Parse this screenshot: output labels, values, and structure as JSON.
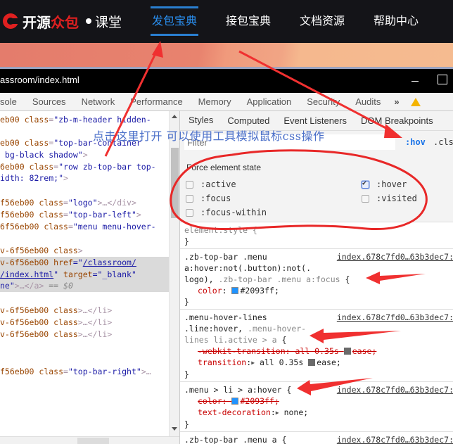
{
  "site": {
    "logo": {
      "part1": "开源",
      "part2": "众包",
      "part3": "课堂"
    },
    "nav": [
      {
        "label": "发包宝典",
        "active": true
      },
      {
        "label": "接包宝典",
        "active": false
      },
      {
        "label": "文档资源",
        "active": false
      },
      {
        "label": "帮助中心",
        "active": false
      }
    ],
    "accent_color": "#2093ff"
  },
  "devtools": {
    "window_title": "assroom/index.html",
    "tabs": [
      "sole",
      "Sources",
      "Network",
      "Performance",
      "Memory",
      "Application",
      "Security",
      "Audits"
    ],
    "more_tabs_icon": "»",
    "elements": {
      "lines": {
        "l0": {
          "pre": "eb00 ",
          "attr": "class",
          "val": "\"zb-m-header hidden-"
        },
        "l1": {
          "pre": "eb00 ",
          "attr": "class",
          "val": "\"top-bar-container"
        },
        "l2": {
          "val": " bg-black shadow\"",
          "post": ">"
        },
        "l3": {
          "pre": "6eb00 ",
          "attr": "class",
          "val": "\"row zb-top-bar top-"
        },
        "l4": {
          "val": "idth: 82rem;\"",
          "post": ">"
        },
        "l5": {
          "pre": "f56eb00 ",
          "attr": "class",
          "val": "\"logo\"",
          "post": ">…</div>"
        },
        "l6": {
          "pre": "f56eb00 ",
          "attr": "class",
          "val": "\"top-bar-left\"",
          "post": ">"
        },
        "l7": {
          "pre": "6f56eb00 ",
          "attr": "class",
          "val": "\"menu menu-hover-"
        },
        "l8": {
          "pre": "v-6f56eb00 ",
          "attr": "class",
          "post": ">"
        },
        "l9": {
          "pre": "v-6f56eb00 ",
          "attr": "href",
          "eq": "=\"",
          "link": "/classroom/"
        },
        "l10": {
          "link": "/index.html",
          "q": "\"",
          "attr": " target",
          "val": "=\"_blank\""
        },
        "l11": {
          "val": "ne\"",
          "post": ">…</a>",
          "console": " == $0"
        },
        "l12": {
          "pre": "v-6f56eb00 ",
          "attr": "class",
          "post": ">…</li>"
        },
        "l13": {
          "pre": "v-6f56eb00 ",
          "attr": "class",
          "post": ">…</li>"
        },
        "l14": {
          "pre": "v-6f56eb00 ",
          "attr": "class",
          "post": ">…</li>"
        },
        "l15": {
          "pre": "f56eb00 ",
          "attr": "class",
          "val": "\"top-bar-right\"",
          "post": ">…"
        }
      }
    },
    "styles": {
      "subtabs": [
        "Styles",
        "Computed",
        "Event Listeners",
        "DOM Breakpoints"
      ],
      "filter_placeholder": "Filter",
      "hov_label": ":hov",
      "cls_label": ".cls",
      "force_state_title": "Force element state",
      "states": [
        {
          "label": ":active",
          "checked": false
        },
        {
          "label": ":focus",
          "checked": false
        },
        {
          "label": ":focus-within",
          "checked": false
        },
        {
          "label": ":hover",
          "checked": true
        },
        {
          "label": ":visited",
          "checked": false
        }
      ],
      "rules": {
        "r0": {
          "selector": "element.style {",
          "close": "}"
        },
        "r1": {
          "selector1": ".zb-top-bar .menu",
          "selector2": "a:hover:not(.button):not(.",
          "selector3a": "logo), ",
          "selector3b": ".zb-top-bar .menu a:focus",
          "brace": " {",
          "source": "index.678c7fd0…63b3dec7:",
          "prop": "color",
          "value": "#2093ff;",
          "close": "}"
        },
        "r2": {
          "selector1": ".menu-hover-lines",
          "selector2a": ".line:hover, ",
          "selector2b": ".menu-hover-",
          "selector3": "lines li.active > a",
          "brace": " {",
          "source": "index.678c7fd0…63b3dec7:",
          "prop1": "-webkit-transition",
          "value1": "all 0.35s",
          "value1b": "ease;",
          "prop2": "transition",
          "value2": "all 0.35s",
          "value2b": "ease;",
          "close": "}"
        },
        "r3": {
          "selector": ".menu > li > a:hover",
          "brace": " {",
          "source": "index.678c7fd0…63b3dec7:",
          "prop1": "color",
          "value1": "#2093ff;",
          "prop2": "text-decoration",
          "value2": "none;",
          "close": "}"
        },
        "r4": {
          "selector": ".zb-top-bar .menu a",
          "brace": " {",
          "source": "index.678c7fd0…63b3dec7:"
        }
      }
    }
  },
  "annotation": {
    "text": "点击这里打开  可以使用工具模拟鼠标css操作"
  }
}
